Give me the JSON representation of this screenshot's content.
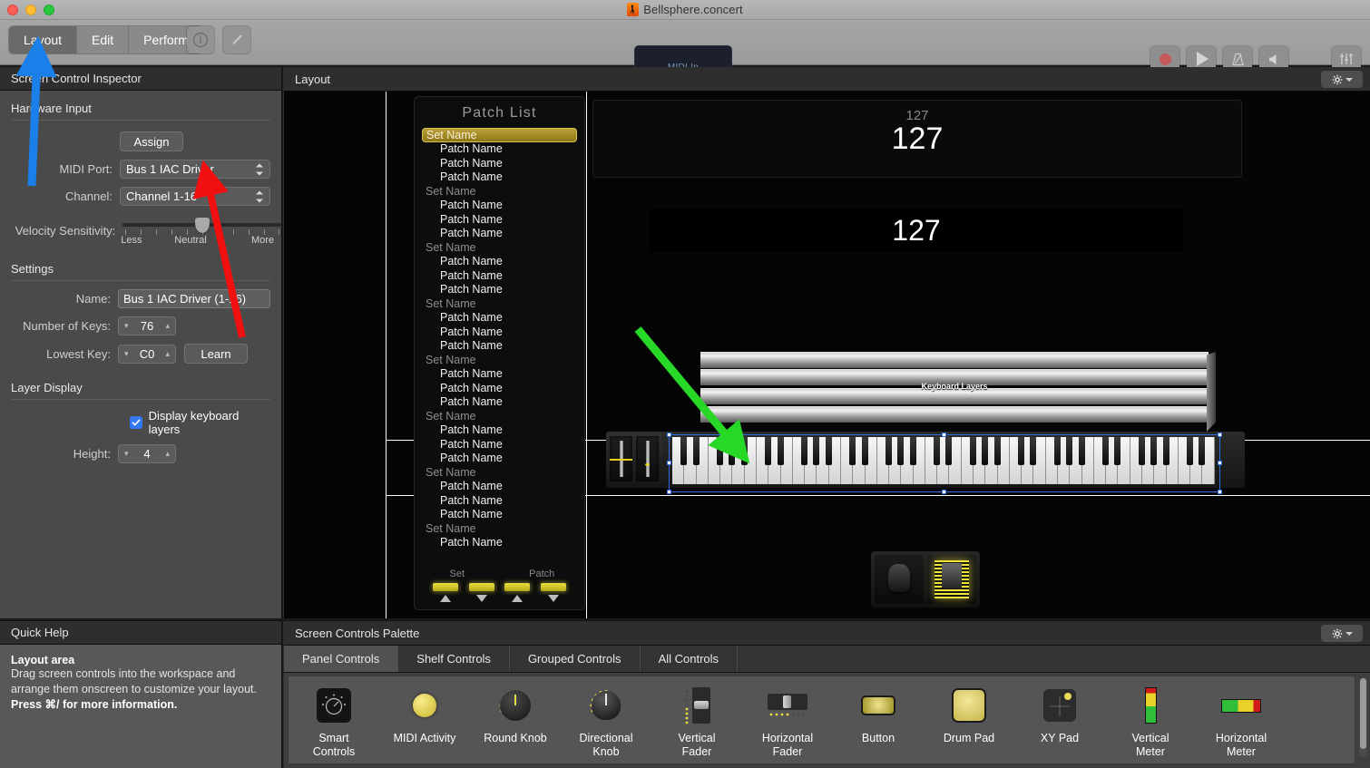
{
  "window": {
    "title": "Bellsphere.concert",
    "doc_icon": "mainstage-document-icon"
  },
  "toolbar": {
    "modes": [
      {
        "label": "Layout",
        "active": true
      },
      {
        "label": "Edit",
        "active": false
      },
      {
        "label": "Perform",
        "active": false
      }
    ],
    "info_icon": "info-circle-icon",
    "pen_icon": "pen-tool-icon",
    "midi_in_label": "MIDI In",
    "transport": [
      {
        "name": "record-button",
        "icon": "record-circle-icon",
        "color": "#c85a5a"
      },
      {
        "name": "play-button",
        "icon": "play-triangle-icon"
      },
      {
        "name": "metronome-button",
        "icon": "metronome-icon"
      },
      {
        "name": "mute-button",
        "icon": "speaker-icon"
      },
      {
        "name": "mixer-button",
        "icon": "sliders-icon"
      }
    ]
  },
  "inspector": {
    "title": "Screen Control Inspector",
    "hardware_input": {
      "section_label": "Hardware Input",
      "assign_label": "Assign",
      "midi_port_label": "MIDI Port:",
      "midi_port_value": "Bus 1 IAC Driver",
      "channel_label": "Channel:",
      "channel_value": "Channel 1-16",
      "velocity_label": "Velocity Sensitivity:",
      "velocity_min": "Less",
      "velocity_mid": "Neutral",
      "velocity_max": "More"
    },
    "settings": {
      "section_label": "Settings",
      "name_label": "Name:",
      "name_value": "Bus 1 IAC Driver (1-16)",
      "keys_label": "Number of Keys:",
      "keys_value": "76",
      "lowest_key_label": "Lowest Key:",
      "lowest_key_value": "C0",
      "learn_label": "Learn"
    },
    "layer_display": {
      "section_label": "Layer Display",
      "checkbox_label": "Display keyboard layers",
      "checkbox_checked": true,
      "height_label": "Height:",
      "height_value": "4"
    }
  },
  "quick_help": {
    "title": "Quick Help",
    "heading": "Layout area",
    "line1": "Drag screen controls into the workspace and",
    "line2": "arrange them onscreen to customize your layout.",
    "line3": "Press ⌘/ for more information."
  },
  "layout": {
    "title": "Layout",
    "gear_icon": "gear-icon",
    "chevron_icon": "chevron-down-icon",
    "patch_list": {
      "title": "Patch List",
      "rows": [
        {
          "type": "set",
          "label": "Set Name",
          "selected": true
        },
        {
          "type": "patch",
          "label": "Patch Name"
        },
        {
          "type": "patch",
          "label": "Patch Name"
        },
        {
          "type": "patch",
          "label": "Patch Name"
        },
        {
          "type": "set",
          "label": "Set Name"
        },
        {
          "type": "patch",
          "label": "Patch Name"
        },
        {
          "type": "patch",
          "label": "Patch Name"
        },
        {
          "type": "patch",
          "label": "Patch Name"
        },
        {
          "type": "set",
          "label": "Set Name"
        },
        {
          "type": "patch",
          "label": "Patch Name"
        },
        {
          "type": "patch",
          "label": "Patch Name"
        },
        {
          "type": "patch",
          "label": "Patch Name"
        },
        {
          "type": "set",
          "label": "Set Name"
        },
        {
          "type": "patch",
          "label": "Patch Name"
        },
        {
          "type": "patch",
          "label": "Patch Name"
        },
        {
          "type": "patch",
          "label": "Patch Name"
        },
        {
          "type": "set",
          "label": "Set Name"
        },
        {
          "type": "patch",
          "label": "Patch Name"
        },
        {
          "type": "patch",
          "label": "Patch Name"
        },
        {
          "type": "patch",
          "label": "Patch Name"
        },
        {
          "type": "set",
          "label": "Set Name"
        },
        {
          "type": "patch",
          "label": "Patch Name"
        },
        {
          "type": "patch",
          "label": "Patch Name"
        },
        {
          "type": "patch",
          "label": "Patch Name"
        },
        {
          "type": "set",
          "label": "Set Name"
        },
        {
          "type": "patch",
          "label": "Patch Name"
        },
        {
          "type": "patch",
          "label": "Patch Name"
        },
        {
          "type": "patch",
          "label": "Patch Name"
        },
        {
          "type": "set",
          "label": "Set Name"
        },
        {
          "type": "patch",
          "label": "Patch Name"
        }
      ],
      "footer": {
        "set_label": "Set",
        "patch_label": "Patch",
        "led_count": 4,
        "up_icon": "triangle-up-icon",
        "down_icon": "triangle-down-icon"
      }
    },
    "displays": {
      "small_value": "127",
      "big_value": "127",
      "lcd_value": "127"
    },
    "keyboard": {
      "layers_label": "Keyboard Layers",
      "layer_count": 4,
      "selected": true
    }
  },
  "palette": {
    "title": "Screen Controls Palette",
    "gear_icon": "gear-icon",
    "chevron_icon": "chevron-down-icon",
    "tabs": [
      {
        "label": "Panel Controls",
        "active": true
      },
      {
        "label": "Shelf Controls",
        "active": false
      },
      {
        "label": "Grouped Controls",
        "active": false
      },
      {
        "label": "All Controls",
        "active": false
      }
    ],
    "items": [
      {
        "label": "Smart\nControls",
        "icon": "smart-controls-icon"
      },
      {
        "label": "MIDI Activity",
        "icon": "midi-activity-icon"
      },
      {
        "label": "Round Knob",
        "icon": "round-knob-icon"
      },
      {
        "label": "Directional\nKnob",
        "icon": "directional-knob-icon"
      },
      {
        "label": "Vertical\nFader",
        "icon": "vertical-fader-icon"
      },
      {
        "label": "Horizontal\nFader",
        "icon": "horizontal-fader-icon"
      },
      {
        "label": "Button",
        "icon": "button-icon"
      },
      {
        "label": "Drum Pad",
        "icon": "drum-pad-icon"
      },
      {
        "label": "XY Pad",
        "icon": "xy-pad-icon"
      },
      {
        "label": "Vertical\nMeter",
        "icon": "vertical-meter-icon"
      },
      {
        "label": "Horizontal\nMeter",
        "icon": "horizontal-meter-icon"
      }
    ]
  },
  "annotations": {
    "blue_arrow": {
      "color": "#1a7fe8",
      "points_to": "layout-mode-button"
    },
    "red_arrow": {
      "color": "#f01010",
      "points_to": "midi-port-popup"
    },
    "green_arrow": {
      "color": "#27d827",
      "points_to": "keyboard-keys"
    }
  }
}
